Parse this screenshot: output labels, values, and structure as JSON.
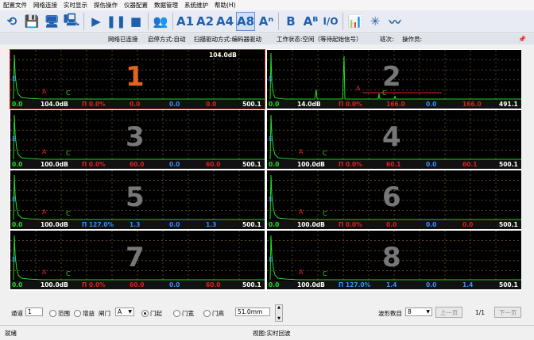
{
  "menu": [
    "配置文件",
    "网络连接",
    "实时显示",
    "探伤操作",
    "仪器配置",
    "数据管理",
    "系统维护",
    "帮助(H)"
  ],
  "toolbar": {
    "buttons": [
      {
        "name": "open-icon",
        "glyph": "⟲"
      },
      {
        "name": "save-icon",
        "glyph": "💾"
      },
      {
        "name": "monitor-icon",
        "glyph": "🖥"
      },
      {
        "name": "monitor-settings-icon",
        "glyph": "🖳"
      },
      {
        "name": "play-icon",
        "glyph": "▶"
      },
      {
        "name": "pause-icon",
        "glyph": "❚❚"
      },
      {
        "name": "stop-icon",
        "glyph": "■"
      },
      {
        "name": "users-icon",
        "glyph": "👥"
      },
      {
        "name": "a1-button",
        "glyph": "A1"
      },
      {
        "name": "a2-button",
        "glyph": "A2"
      },
      {
        "name": "a4-button",
        "glyph": "A4"
      },
      {
        "name": "a8-button",
        "glyph": "A8"
      },
      {
        "name": "an-button",
        "glyph": "Aⁿ"
      },
      {
        "name": "b-button",
        "glyph": "B"
      },
      {
        "name": "ab-button",
        "glyph": "Aᴮ"
      },
      {
        "name": "io-button",
        "glyph": "I/O"
      },
      {
        "name": "chart-icon",
        "glyph": "📊"
      },
      {
        "name": "burst-icon",
        "glyph": "✳"
      },
      {
        "name": "wave-icon",
        "glyph": "〰"
      }
    ]
  },
  "status": {
    "net": "网络已连接",
    "start_mode": "启停方式:自动",
    "scan_drive": "扫描驱动方式:编码器驱动",
    "work_state": "工作状态:空闲（等待起始信号）",
    "shift": "班次:",
    "operator": "操作员:"
  },
  "channels": [
    {
      "n": "1",
      "start": "0.0",
      "gain": "104.0dB",
      "top_gain": "104.0dB",
      "gate": "Π 0.0%",
      "c1": "0.0",
      "c2": "0.0",
      "c3": "0.0",
      "end": "500.1",
      "active": true
    },
    {
      "n": "2",
      "start": "0.0",
      "gain": "14.0dB",
      "gate": "Π 0.0%",
      "c1": "166.0",
      "c2": "0.0",
      "c3": "166.0",
      "end": "491.1",
      "active": false
    },
    {
      "n": "3",
      "start": "0.0",
      "gain": "100.0dB",
      "gate": "Π 0.0%",
      "c1": "60.0",
      "c2": "0.0",
      "c3": "60.0",
      "end": "500.1",
      "active": false
    },
    {
      "n": "4",
      "start": "0.0",
      "gain": "100.0dB",
      "gate": "Π 0.0%",
      "c1": "60.1",
      "c2": "0.0",
      "c3": "60.1",
      "end": "500.1",
      "active": false
    },
    {
      "n": "5",
      "start": "0.0",
      "gain": "100.0dB",
      "gate": "Π 127.0%",
      "c1": "1.3",
      "c2": "0.0",
      "c3": "1.3",
      "end": "500.1",
      "active": false
    },
    {
      "n": "6",
      "start": "0.0",
      "gain": "100.0dB",
      "gate": "Π 0.0%",
      "c1": "0.0",
      "c2": "0.0",
      "c3": "0.0",
      "end": "500.1",
      "active": false
    },
    {
      "n": "7",
      "start": "0.0",
      "gain": "100.0dB",
      "gate": "Π 0.0%",
      "c1": "60.0",
      "c2": "0.0",
      "c3": "60.0",
      "end": "500.1",
      "active": false
    },
    {
      "n": "8",
      "start": "0.0",
      "gain": "100.0dB",
      "gate": "Π 127.0%",
      "c1": "1.4",
      "c2": "0.0",
      "c3": "1.4",
      "end": "500.1",
      "active": false
    }
  ],
  "controls": {
    "channel_label": "通道",
    "channel_value": "1",
    "range": "范围",
    "gain": "增益",
    "gate_label": "闸门",
    "gate_value": "A",
    "gate_start": "门起",
    "gate_width": "门宽",
    "gate_height": "门高",
    "param_value": "51.0mm",
    "wave_count_label": "波形数目",
    "wave_count_value": "8",
    "prev": "上一页",
    "page": "1/1",
    "next": "下一页"
  },
  "bottom": {
    "ready": "就绪",
    "view": "视图:实时回波"
  }
}
